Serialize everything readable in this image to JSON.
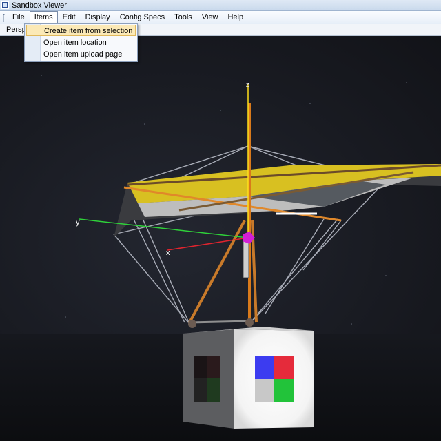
{
  "window": {
    "title": "Sandbox Viewer"
  },
  "menu": {
    "file": "File",
    "items": "Items",
    "edit": "Edit",
    "display": "Display",
    "config_specs": "Config Specs",
    "tools": "Tools",
    "view": "View",
    "help": "Help"
  },
  "items_menu": {
    "create_from_selection": "Create item from selection",
    "open_location": "Open item location",
    "open_upload_page": "Open item upload page"
  },
  "toolbar": {
    "view_mode": "Persp"
  },
  "viewport": {
    "axis_x": "x",
    "axis_y": "y",
    "axis_z": "z"
  },
  "colors": {
    "axis_x": "#e0242e",
    "axis_y": "#2fd13a",
    "axis_z": "#ffe01a",
    "menu_highlight": "#fbe9b6",
    "wing_yellow": "#e3c21f"
  }
}
